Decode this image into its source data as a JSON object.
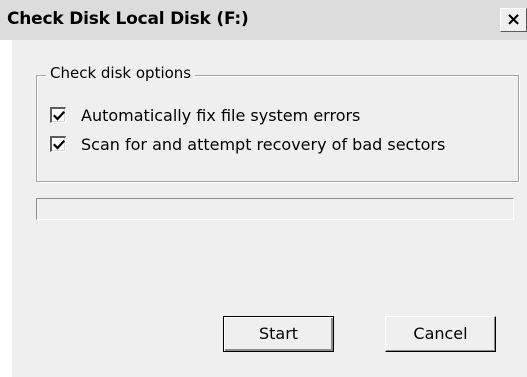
{
  "window": {
    "title": "Check Disk Local Disk (F:)",
    "close_label": "×"
  },
  "options": {
    "group_label": "Check disk options",
    "items": [
      {
        "label": "Automatically fix file system errors",
        "checked": true
      },
      {
        "label": "Scan for and attempt recovery of bad sectors",
        "checked": true
      }
    ]
  },
  "progress": {
    "value": 0
  },
  "buttons": {
    "start_label": "Start",
    "cancel_label": "Cancel"
  }
}
